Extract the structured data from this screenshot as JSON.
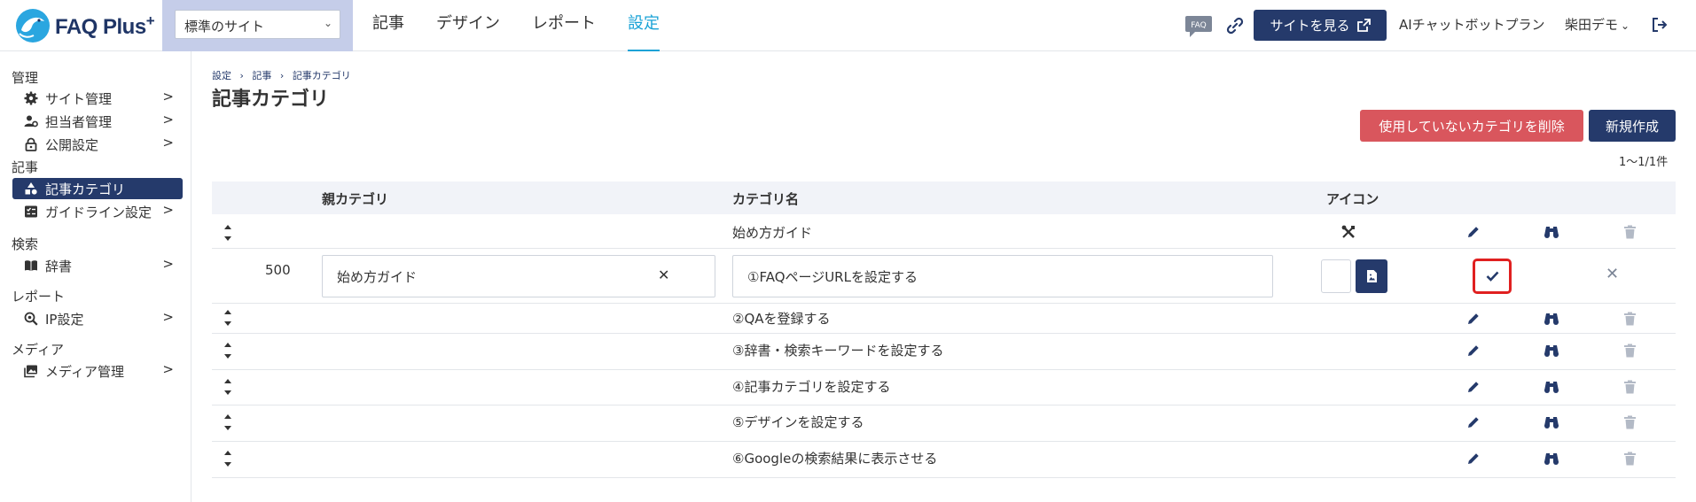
{
  "header": {
    "logo_text": "FAQ Plus",
    "logo_plus": "+",
    "site_select_value": "標準のサイト",
    "nav": [
      "記事",
      "デザイン",
      "レポート",
      "設定"
    ],
    "nav_active_index": 3,
    "faq_badge": "FAQ",
    "view_site_label": "サイトを見る",
    "plan_text": "AIチャットボットプラン",
    "user_name": "柴田デモ"
  },
  "sidebar": {
    "sections": [
      {
        "label": "管理",
        "items": [
          {
            "label": "サイト管理",
            "icon": "gear-icon"
          },
          {
            "label": "担当者管理",
            "icon": "users-gear-icon"
          },
          {
            "label": "公開設定",
            "icon": "lock-icon"
          }
        ]
      },
      {
        "label": "記事",
        "items": [
          {
            "label": "記事カテゴリ",
            "icon": "shapes-icon",
            "active": true
          },
          {
            "label": "ガイドライン設定",
            "icon": "checklist-icon"
          }
        ]
      },
      {
        "label": "検索",
        "items": [
          {
            "label": "辞書",
            "icon": "book-icon"
          }
        ]
      },
      {
        "label": "レポート",
        "items": [
          {
            "label": "IP設定",
            "icon": "magnify-gear-icon"
          }
        ]
      },
      {
        "label": "メディア",
        "items": [
          {
            "label": "メディア管理",
            "icon": "images-icon"
          }
        ]
      }
    ],
    "arrow": ">"
  },
  "main": {
    "breadcrumb": [
      "設定",
      "›",
      "記事",
      "›",
      "記事カテゴリ"
    ],
    "title": "記事カテゴリ",
    "delete_unused_label": "使用していないカテゴリを削除",
    "new_label": "新規作成",
    "count": "1〜1/1件",
    "columns": [
      "親カテゴリ",
      "カテゴリ名",
      "アイコン"
    ],
    "rows": [
      {
        "name": "始め方ガイド",
        "has_icon": true
      },
      {
        "name": "②QAを登録する"
      },
      {
        "name": "③辞書・検索キーワードを設定する"
      },
      {
        "name": "④記事カテゴリを設定する"
      },
      {
        "name": "⑤デザインを設定する"
      },
      {
        "name": "⑥Googleの検索結果に表示させる"
      }
    ],
    "edit_row": {
      "order": "500",
      "parent_value": "始め方ガイド",
      "name_value": "①FAQページURLを設定する"
    }
  },
  "colors": {
    "navy": "#253a6b",
    "accent_blue": "#19a2d6",
    "danger": "#d9565d",
    "highlight": "#e02020"
  }
}
